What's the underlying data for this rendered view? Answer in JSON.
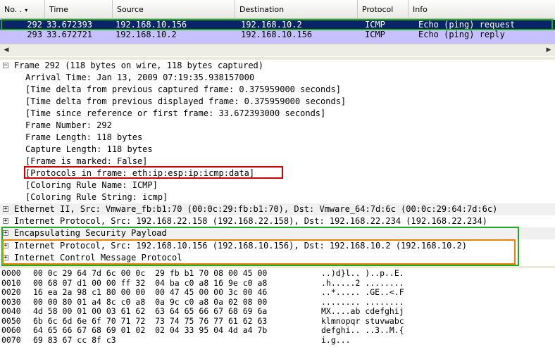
{
  "packet_list": {
    "columns": [
      "No. .",
      "Time",
      "Source",
      "Destination",
      "Protocol",
      "Info"
    ],
    "sort_indicator": "▾",
    "rows": [
      {
        "no": "292",
        "time": "33.672393",
        "src": "192.168.10.156",
        "dst": "192.168.10.2",
        "proto": "ICMP",
        "info": "Echo (ping) request"
      },
      {
        "no": "293",
        "time": "33.672721",
        "src": "192.168.10.2",
        "dst": "192.168.10.156",
        "proto": "ICMP",
        "info": "Echo (ping) reply"
      }
    ]
  },
  "details": {
    "frame": "Frame 292 (118 bytes on wire, 118 bytes captured)",
    "frame_fields": [
      "Arrival Time: Jan 13, 2009 07:19:35.938157000",
      "[Time delta from previous captured frame: 0.375959000 seconds]",
      "[Time delta from previous displayed frame: 0.375959000 seconds]",
      "[Time since reference or first frame: 33.672393000 seconds]",
      "Frame Number: 292",
      "Frame Length: 118 bytes",
      "Capture Length: 118 bytes",
      "[Frame is marked: False]",
      "[Protocols in frame: eth:ip:esp:ip:icmp:data]",
      "[Coloring Rule Name: ICMP]",
      "[Coloring Rule String: icmp]"
    ],
    "ethernet": "Ethernet II, Src: Vmware_fb:b1:70 (00:0c:29:fb:b1:70), Dst: Vmware_64:7d:6c (00:0c:29:64:7d:6c)",
    "ip_outer": "Internet Protocol, Src: 192.168.22.158 (192.168.22.158), Dst: 192.168.22.234 (192.168.22.234)",
    "esp": "Encapsulating Security Payload",
    "ip_inner": "Internet Protocol, Src: 192.168.10.156 (192.168.10.156), Dst: 192.168.10.2 (192.168.10.2)",
    "icmp": "Internet Control Message Protocol",
    "expanded_glyph": "−",
    "collapsed_glyph": "+"
  },
  "bytes": [
    {
      "off": "0000",
      "hex": "00 0c 29 64 7d 6c 00 0c  29 fb b1 70 08 00 45 00",
      "ascii": "..)d}l.. )..p..E."
    },
    {
      "off": "0010",
      "hex": "00 68 07 d1 00 00 ff 32  04 ba c0 a8 16 9e c0 a8",
      "ascii": ".h.....2 ........"
    },
    {
      "off": "0020",
      "hex": "16 ea 2a 98 c1 80 00 00  00 47 45 00 00 3c 00 46",
      "ascii": "..*..... .GE..<.F"
    },
    {
      "off": "0030",
      "hex": "00 00 80 01 a4 8c c0 a8  0a 9c c0 a8 0a 02 08 00",
      "ascii": "........ ........"
    },
    {
      "off": "0040",
      "hex": "4d 58 00 01 00 03 61 62  63 64 65 66 67 68 69 6a",
      "ascii": "MX....ab cdefghij"
    },
    {
      "off": "0050",
      "hex": "6b 6c 6d 6e 6f 70 71 72  73 74 75 76 77 61 62 63",
      "ascii": "klmnopqr stuvwabc"
    },
    {
      "off": "0060",
      "hex": "64 65 66 67 68 69 01 02  02 04 33 95 04 4d a4 7b",
      "ascii": "defghi.. ..3..M.{"
    },
    {
      "off": "0070",
      "hex": "69 83 67 cc 8f c3",
      "ascii": "i.g..."
    }
  ],
  "colors": {
    "selected_row": "#0a246a",
    "icmp_row": "#c7c0ff",
    "highlight_red": "#d00000",
    "highlight_green": "#22aa22",
    "highlight_orange": "#f08000"
  }
}
